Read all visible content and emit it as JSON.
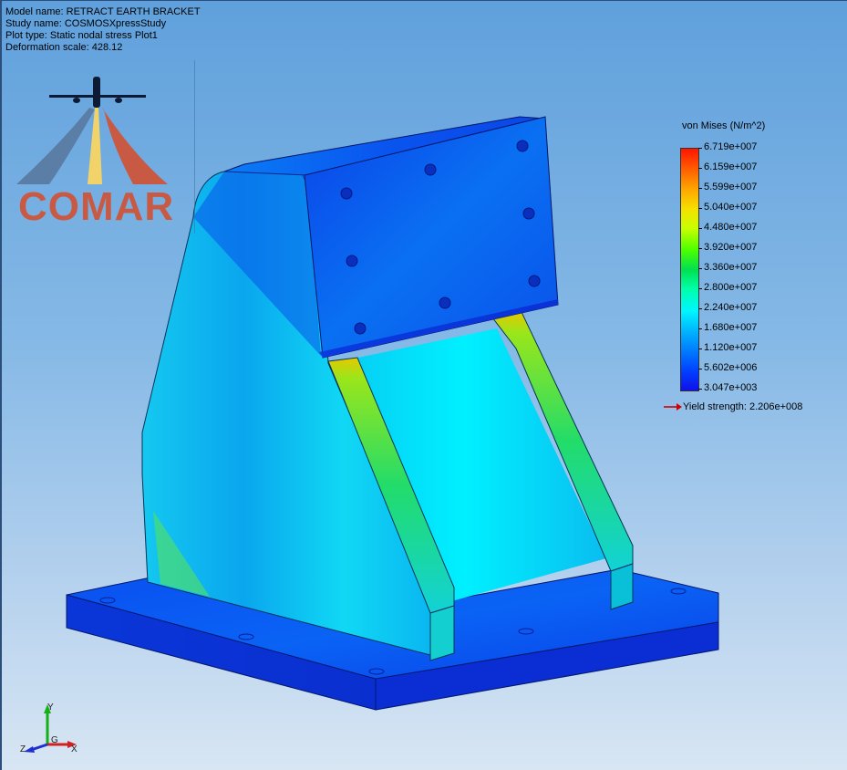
{
  "info": {
    "model": "Model name: RETRACT EARTH BRACKET",
    "study": "Study name: COSMOSXpressStudy",
    "plot": "Plot type: Static nodal stress Plot1",
    "deformation": "Deformation scale: 428.12"
  },
  "logo": {
    "text": "COMAR",
    "brand_color": "#c85a44"
  },
  "legend": {
    "title": "von Mises (N/m^2)",
    "labels": [
      "6.719e+007",
      "6.159e+007",
      "5.599e+007",
      "5.040e+007",
      "4.480e+007",
      "3.920e+007",
      "3.360e+007",
      "2.800e+007",
      "2.240e+007",
      "1.680e+007",
      "1.120e+007",
      "5.602e+006",
      "3.047e+003"
    ],
    "yield": "Yield strength: 2.206e+008",
    "yield_color": "#d40000"
  },
  "triad": {
    "y": "Y",
    "x": "X",
    "z": "Z",
    "origin": "G"
  },
  "colors": {
    "background_top": "#5fa0dc",
    "background_bottom": "#d8e6f3"
  }
}
